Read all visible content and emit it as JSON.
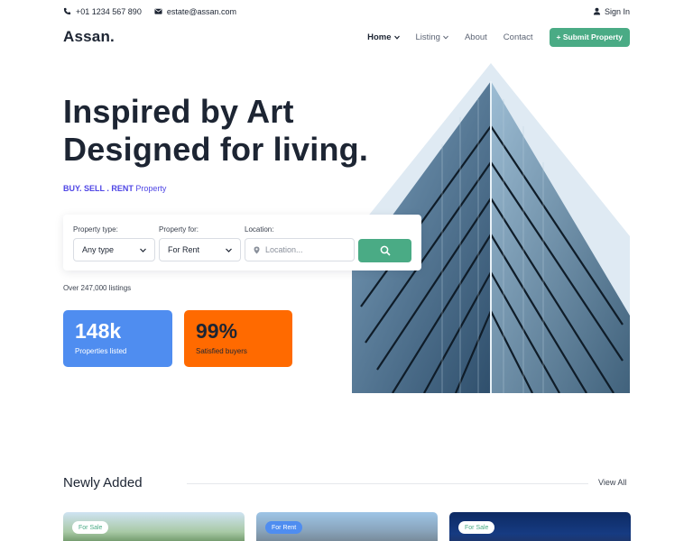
{
  "topbar": {
    "phone": "+01 1234 567 890",
    "email": "estate@assan.com",
    "signin": "Sign In"
  },
  "nav": {
    "logo": "Assan.",
    "items": [
      {
        "label": "Home",
        "has_dropdown": true,
        "active": true
      },
      {
        "label": "Listing",
        "has_dropdown": true,
        "active": false
      },
      {
        "label": "About",
        "has_dropdown": false,
        "active": false
      },
      {
        "label": "Contact",
        "has_dropdown": false,
        "active": false
      }
    ],
    "submit_label": "+ Submit Property"
  },
  "hero": {
    "headline_line1": "Inspired by Art",
    "headline_line2": "Designed for living.",
    "tagline_bold": "BUY. SELL . RENT",
    "tagline_rest": "Property"
  },
  "search": {
    "property_type_label": "Property type:",
    "property_type_value": "Any type",
    "property_for_label": "Property for:",
    "property_for_value": "For Rent",
    "location_label": "Location:",
    "location_placeholder": "Location...",
    "listings_count": "Over 247,000 listings"
  },
  "stats": [
    {
      "value": "148k",
      "caption": "Properties listed",
      "color": "#4f8df0"
    },
    {
      "value": "99%",
      "caption": "Satisfied buyers",
      "color": "#ff6a00"
    }
  ],
  "newly_added": {
    "title": "Newly Added",
    "view_all": "View All",
    "cards": [
      {
        "badge": "For Sale"
      },
      {
        "badge": "For Rent"
      },
      {
        "badge": "For Sale"
      }
    ]
  },
  "colors": {
    "accent_green": "#4aab85",
    "accent_purple": "#4f46e5",
    "text_dark": "#1d2533"
  }
}
